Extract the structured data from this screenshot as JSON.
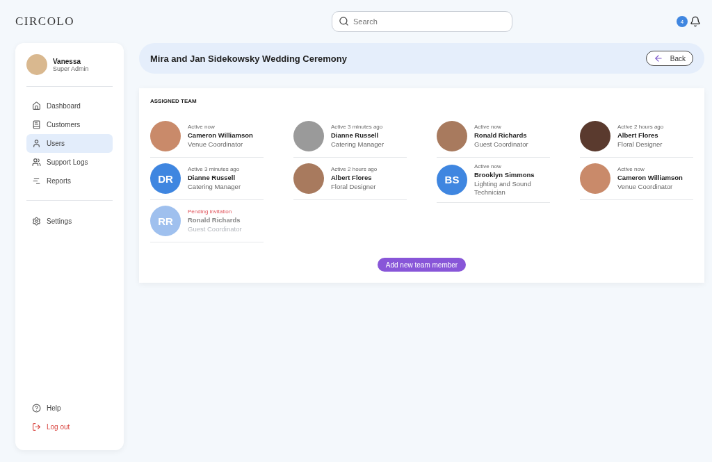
{
  "header": {
    "logo": "CIRCOLO",
    "search": {
      "placeholder": "Search"
    },
    "notification_count": "4"
  },
  "sidebar": {
    "user": {
      "name": "Vanessa",
      "role": "Super Admin"
    },
    "items": [
      {
        "label": "Dashboard",
        "selected": false
      },
      {
        "label": "Customers",
        "selected": false
      },
      {
        "label": "Users",
        "selected": true
      },
      {
        "label": "Support Logs",
        "selected": false
      },
      {
        "label": "Reports",
        "selected": false
      }
    ],
    "settings": {
      "label": "Settings"
    },
    "footer": [
      {
        "label": "Help",
        "kind": "help"
      },
      {
        "label": "Log out",
        "kind": "logout"
      }
    ]
  },
  "page": {
    "title": "Mira and Jan Sidekowsky Wedding Ceremony",
    "back_button": "Back"
  },
  "team": {
    "heading": "ASSIGNED TEAM",
    "columns": [
      [
        {
          "kind": "photo",
          "status": "Active now",
          "pending": false,
          "name": "Cameron Williamson",
          "role": "Venue Coordinator"
        },
        {
          "kind": "initials",
          "initials": "DR",
          "status": "Active 3 minutes ago",
          "pending": false,
          "name": "Dianne Russell",
          "role": "Catering Manager"
        },
        {
          "kind": "initials",
          "initials": "RR",
          "status": "Pending invitation",
          "pending": true,
          "name": "Ronald Richards",
          "role": "Guest Coordinator"
        }
      ],
      [
        {
          "kind": "photo",
          "status": "Active 3 minutes ago",
          "pending": false,
          "name": "Dianne Russell",
          "role": "Catering Manager"
        },
        {
          "kind": "photo",
          "status": "Active 2 hours ago",
          "pending": false,
          "name": "Albert Flores",
          "role": "Floral Designer"
        }
      ],
      [
        {
          "kind": "photo",
          "status": "Active now",
          "pending": false,
          "name": "Ronald Richards",
          "role": "Guest Coordinator"
        },
        {
          "kind": "initials",
          "initials": "BS",
          "status": "Active now",
          "pending": false,
          "name": "Brooklyn Simmons",
          "role": "Lighting and Sound Technician"
        }
      ],
      [
        {
          "kind": "photo",
          "status": "Active 2 hours ago",
          "pending": false,
          "name": "Albert Flores",
          "role": "Floral Designer"
        },
        {
          "kind": "photo",
          "status": "Active now",
          "pending": false,
          "name": "Cameron Williamson",
          "role": "Venue Coordinator"
        }
      ]
    ],
    "add_button": "Add new team member"
  }
}
